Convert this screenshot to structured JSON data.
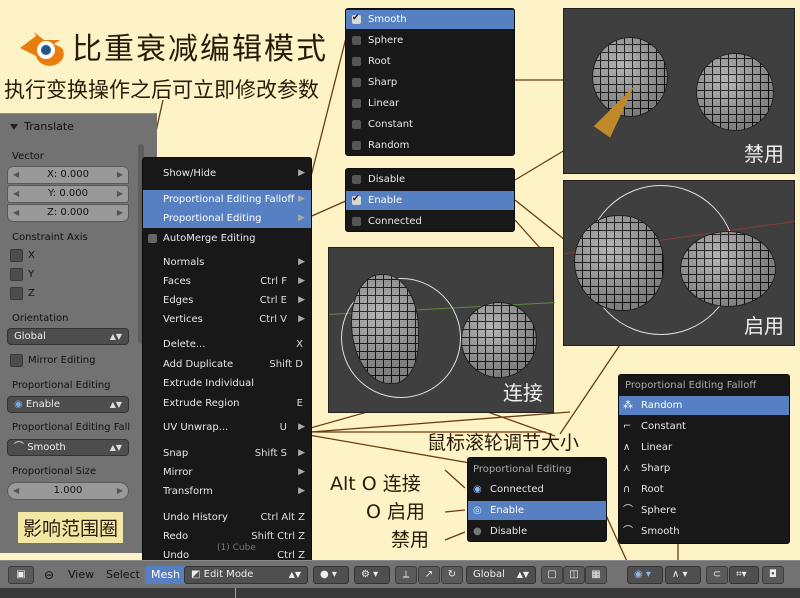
{
  "title": "比重衰减编辑模式",
  "subtitle": "执行变换操作之后可立即修改参数",
  "tool_panel": {
    "header": "Translate",
    "vector_label": "Vector",
    "vector": [
      "X: 0.000",
      "Y: 0.000",
      "Z: 0.000"
    ],
    "constraint_label": "Constraint Axis",
    "axes": [
      "X",
      "Y",
      "Z"
    ],
    "orientation_label": "Orientation",
    "orientation_value": "Global",
    "mirror_label": "Mirror Editing",
    "prop_editing_label": "Proportional Editing",
    "prop_editing_value": "Enable",
    "falloff_label": "Proportional Editing Fall",
    "falloff_value": "Smooth",
    "size_label": "Proportional Size",
    "size_value": "1.000"
  },
  "mesh_menu": {
    "items": [
      {
        "label": "Show/Hide",
        "shortcut": "",
        "arrow": true
      },
      {
        "label": "Proportional Editing Falloff",
        "shortcut": "",
        "arrow": true,
        "selected": true
      },
      {
        "label": "Proportional Editing",
        "shortcut": "",
        "arrow": true,
        "selected": true
      },
      {
        "label": "AutoMerge Editing",
        "shortcut": "",
        "checkbox": true
      },
      {
        "label": "Normals",
        "shortcut": "",
        "arrow": true
      },
      {
        "label": "Faces",
        "shortcut": "Ctrl F",
        "arrow": true
      },
      {
        "label": "Edges",
        "shortcut": "Ctrl E",
        "arrow": true
      },
      {
        "label": "Vertices",
        "shortcut": "Ctrl V",
        "arrow": true
      },
      {
        "label": "Delete...",
        "shortcut": "X"
      },
      {
        "label": "Add Duplicate",
        "shortcut": "Shift D"
      },
      {
        "label": "Extrude Individual",
        "shortcut": ""
      },
      {
        "label": "Extrude Region",
        "shortcut": "E"
      },
      {
        "label": "UV Unwrap...",
        "shortcut": "U"
      },
      {
        "label": "Snap",
        "shortcut": "Shift S",
        "arrow": true
      },
      {
        "label": "Mirror",
        "shortcut": "",
        "arrow": true
      },
      {
        "label": "Transform",
        "shortcut": "",
        "arrow": true
      },
      {
        "label": "Undo History",
        "shortcut": "Ctrl Alt Z"
      },
      {
        "label": "Redo",
        "shortcut": "Shift Ctrl Z"
      },
      {
        "label": "Undo",
        "shortcut": "Ctrl Z"
      }
    ],
    "overlay_text": "(1) Cube"
  },
  "falloff_menu": {
    "items": [
      {
        "label": "Smooth",
        "checked": true,
        "selected": true
      },
      {
        "label": "Sphere"
      },
      {
        "label": "Root"
      },
      {
        "label": "Sharp"
      },
      {
        "label": "Linear"
      },
      {
        "label": "Constant"
      },
      {
        "label": "Random"
      }
    ]
  },
  "mode_menu": {
    "items": [
      {
        "label": "Disable"
      },
      {
        "label": "Enable",
        "checked": true,
        "selected": true
      },
      {
        "label": "Connected"
      }
    ]
  },
  "viewports": {
    "disabled_label": "禁用",
    "enabled_label": "启用",
    "connected_label": "连接"
  },
  "falloff_popup": {
    "header": "Proportional Editing Falloff",
    "items": [
      {
        "label": "Random",
        "icon": "⁂",
        "selected": true
      },
      {
        "label": "Constant",
        "icon": "⌐"
      },
      {
        "label": "Linear",
        "icon": "∧"
      },
      {
        "label": "Sharp",
        "icon": "⋏"
      },
      {
        "label": "Root",
        "icon": "∩"
      },
      {
        "label": "Sphere",
        "icon": "⌒"
      },
      {
        "label": "Smooth",
        "icon": "⌒"
      }
    ]
  },
  "editing_popup": {
    "header": "Proportional Editing",
    "items": [
      {
        "label": "Connected"
      },
      {
        "label": "Enable",
        "selected": true
      },
      {
        "label": "Disable"
      }
    ]
  },
  "annotations": {
    "scroll": "鼠标滚轮调节大小",
    "alt_o": "Alt O 连接",
    "o": "O 启用",
    "disable": "禁用",
    "influence": "影响范围圈"
  },
  "toolbar": {
    "view": "View",
    "select": "Select",
    "mesh": "Mesh",
    "mode": "Edit Mode",
    "orientation": "Global"
  },
  "colors": {
    "selection": "#5680c2",
    "background": "#fdf3c6",
    "annotation_line": "#6b3b12"
  }
}
